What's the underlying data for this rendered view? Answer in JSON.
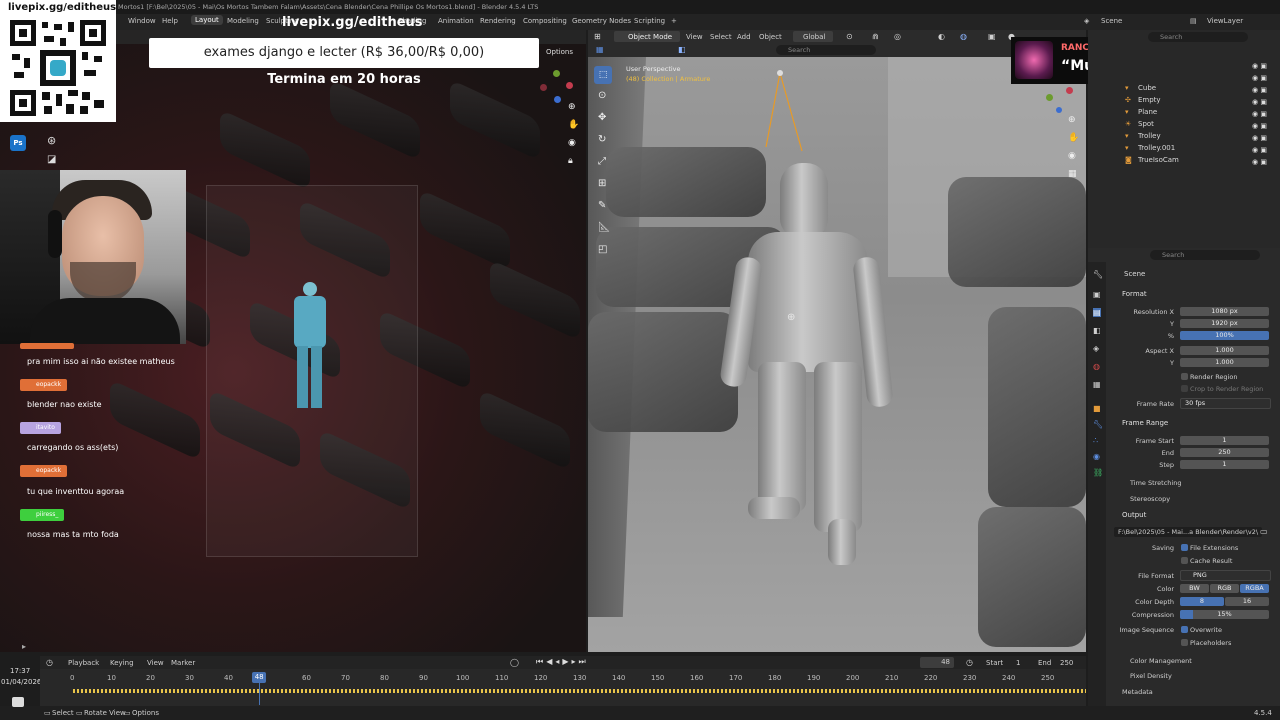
{
  "title_bar": "Mortos1 [F:\\Bel\\2025\\05 - Mai\\Os Mortos Tambem Falam\\Assets\\Cena Blender\\Cena Phillipe Os Mortos1.blend] - Blender 4.5.4 LTS",
  "menus": [
    "Window",
    "Help"
  ],
  "workspaces": [
    "Layout",
    "Modeling",
    "Sculpting",
    "UV Editing",
    "Texture Paint",
    "Shading",
    "Animation",
    "Rendering",
    "Compositing",
    "Geometry Nodes",
    "Scripting"
  ],
  "add_workspace": "+",
  "scene_name": "Scene",
  "viewlayer_name": "ViewLayer",
  "stream": {
    "url": "livepix.gg/editheus",
    "donation_text": "exames django e lecter (R$ 36,00/R$ 0,00)",
    "countdown": "Termina em 20 horas",
    "alert_name": "RANCORE",
    "alert_message": "“Mulher”"
  },
  "chat": [
    {
      "user": "",
      "message": "pra mim isso ai não existee matheus",
      "color": "#e06f37"
    },
    {
      "user": "eopackk",
      "message": "blender nao existe",
      "color": "#e06f37"
    },
    {
      "user": "itavito",
      "message": "carregando os ass(ets)",
      "color": "#b7a3e0"
    },
    {
      "user": "eopackk",
      "message": "tu que inventtou agoraa",
      "color": "#e06f37"
    },
    {
      "user": "piiress_",
      "message": "nossa mas ta mto foda",
      "color": "#3ecf3e"
    }
  ],
  "clock": {
    "time": "17:37",
    "date": "01/04/2026"
  },
  "left_viewport": {
    "options": "Options"
  },
  "viewport_header": {
    "mode": "Object Mode",
    "menus": [
      "View",
      "Select",
      "Add",
      "Object"
    ],
    "orientation": "Global",
    "search_placeholder": "Search"
  },
  "viewport_overlay": {
    "perspective": "User Perspective",
    "collection": "(48) Collection | Armature"
  },
  "outliner": {
    "search_placeholder": "Search",
    "items": [
      {
        "name": "Cube",
        "icon": "mesh-icon"
      },
      {
        "name": "Empty",
        "icon": "empty-icon"
      },
      {
        "name": "Plane",
        "icon": "mesh-icon"
      },
      {
        "name": "Spot",
        "icon": "light-icon"
      },
      {
        "name": "Trolley",
        "icon": "mesh-icon"
      },
      {
        "name": "Trolley.001",
        "icon": "mesh-icon"
      },
      {
        "name": "TrueIsoCam",
        "icon": "camera-icon"
      }
    ]
  },
  "properties": {
    "search_placeholder": "Search",
    "context": "Scene",
    "format_header": "Format",
    "resolution_x_label": "Resolution X",
    "resolution_x": "1080 px",
    "resolution_y_label": "Y",
    "resolution_y": "1920 px",
    "resolution_pct_label": "%",
    "resolution_pct": "100%",
    "aspect_x_label": "Aspect X",
    "aspect_x": "1.000",
    "aspect_y_label": "Y",
    "aspect_y": "1.000",
    "render_region": "Render Region",
    "crop_region": "Crop to Render Region",
    "frame_rate_label": "Frame Rate",
    "frame_rate": "30 fps",
    "frame_range_header": "Frame Range",
    "frame_start_label": "Frame Start",
    "frame_start": "1",
    "end_label": "End",
    "end": "250",
    "step_label": "Step",
    "step": "1",
    "time_stretching": "Time Stretching",
    "stereoscopy": "Stereoscopy",
    "output_header": "Output",
    "output_path": "F:\\Bel\\2025\\05 - Mai...a Blender\\Render\\v2\\",
    "saving_label": "Saving",
    "file_extensions": "File Extensions",
    "cache_result": "Cache Result",
    "file_format_label": "File Format",
    "file_format": "PNG",
    "color_label": "Color",
    "color_options": [
      "BW",
      "RGB",
      "RGBA"
    ],
    "color_depth_label": "Color Depth",
    "color_depth_options": [
      "8",
      "16"
    ],
    "compression_label": "Compression",
    "compression": "15%",
    "compression_value": 0.15,
    "image_sequence_label": "Image Sequence",
    "overwrite": "Overwrite",
    "placeholders": "Placeholders",
    "color_management": "Color Management",
    "pixel_density": "Pixel Density",
    "metadata": "Metadata"
  },
  "timeline": {
    "menus": [
      "Playback",
      "Keying",
      "View",
      "Marker"
    ],
    "current_frame": "48",
    "start_label": "Start",
    "start": "1",
    "end_label": "End",
    "end": "250",
    "ticks": [
      "0",
      "10",
      "20",
      "30",
      "40",
      "48",
      "60",
      "70",
      "80",
      "90",
      "100",
      "110",
      "120",
      "130",
      "140",
      "150",
      "160",
      "170",
      "180",
      "190",
      "200",
      "210",
      "220",
      "230",
      "240",
      "250"
    ],
    "playhead_frame": 48
  },
  "status": {
    "select": "Select",
    "rotate": "Rotate View",
    "options": "Options",
    "version": "4.5.4"
  },
  "colors": {
    "accent": "#4772b3",
    "header": "#2b2b2b",
    "keyframe": "#e8c44a",
    "blood": "#4a1e22"
  }
}
